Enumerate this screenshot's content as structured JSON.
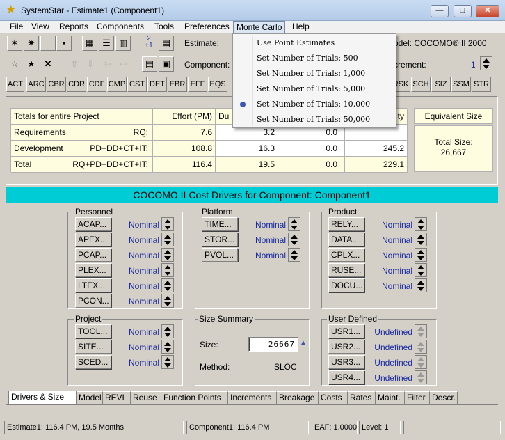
{
  "window": {
    "title": "SystemStar - Estimate1 (Component1)",
    "app_icon": "star-icon",
    "minimize": "—",
    "maximize": "□",
    "close": "✕"
  },
  "menubar": {
    "items": [
      "File",
      "View",
      "Reports",
      "Components",
      "Tools",
      "Preferences",
      "Monte Carlo",
      "Help"
    ]
  },
  "toolbar": {
    "estimate_label": "Estimate:",
    "component_label": "Component:",
    "model_label": "odel: COCOMO® II 2000",
    "increment_label": "crement:",
    "increment_value": "1",
    "fraction_top": "2",
    "fraction_bottom": "+1"
  },
  "cost_driver_buttons": [
    "ACT",
    "ARC",
    "CBR",
    "CDR",
    "CDF",
    "CMP",
    "CST",
    "DET",
    "EBR",
    "EFF",
    "EQS",
    "RSK",
    "SCH",
    "SIZ",
    "SSM",
    "STR"
  ],
  "totals": {
    "header": [
      "Totals for entire Project",
      "Effort (PM)",
      "Du",
      "",
      "ty"
    ],
    "rows": [
      {
        "name": "Requirements",
        "formula": "RQ:",
        "effort": "7.6",
        "duration": "3.2",
        "staff": "0.0",
        "productivity": ""
      },
      {
        "name": "Development",
        "formula": "PD+DD+CT+IT:",
        "effort": "108.8",
        "duration": "16.3",
        "staff": "0.0",
        "productivity": "245.2"
      },
      {
        "name": "Total",
        "formula": "RQ+PD+DD+CT+IT:",
        "effort": "116.4",
        "duration": "19.5",
        "staff": "0.0",
        "productivity": "229.1"
      }
    ],
    "equivalent_size": {
      "header": "Equivalent Size",
      "label": "Total Size:",
      "value": "26,667"
    }
  },
  "cost_drivers": {
    "title": "COCOMO II Cost Drivers for Component: Component1",
    "personnel": {
      "title": "Personnel",
      "items": [
        {
          "label": "ACAP...",
          "value": "Nominal"
        },
        {
          "label": "APEX...",
          "value": "Nominal"
        },
        {
          "label": "PCAP...",
          "value": "Nominal"
        },
        {
          "label": "PLEX...",
          "value": "Nominal"
        },
        {
          "label": "LTEX...",
          "value": "Nominal"
        },
        {
          "label": "PCON...",
          "value": "Nominal"
        }
      ]
    },
    "platform": {
      "title": "Platform",
      "items": [
        {
          "label": "TIME...",
          "value": "Nominal"
        },
        {
          "label": "STOR...",
          "value": "Nominal"
        },
        {
          "label": "PVOL...",
          "value": "Nominal"
        }
      ]
    },
    "product": {
      "title": "Product",
      "items": [
        {
          "label": "RELY...",
          "value": "Nominal"
        },
        {
          "label": "DATA...",
          "value": "Nominal"
        },
        {
          "label": "CPLX...",
          "value": "Nominal"
        },
        {
          "label": "RUSE...",
          "value": "Nominal"
        },
        {
          "label": "DOCU...",
          "value": "Nominal"
        }
      ]
    },
    "project": {
      "title": "Project",
      "items": [
        {
          "label": "TOOL...",
          "value": "Nominal"
        },
        {
          "label": "SITE...",
          "value": "Nominal"
        },
        {
          "label": "SCED...",
          "value": "Nominal"
        }
      ]
    },
    "size_summary": {
      "title": "Size Summary",
      "size_label": "Size:",
      "size_value": "26667",
      "method_label": "Method:",
      "method_value": "SLOC"
    },
    "user_defined": {
      "title": "User Defined",
      "items": [
        {
          "label": "USR1...",
          "value": "Undefined"
        },
        {
          "label": "USR2...",
          "value": "Undefined"
        },
        {
          "label": "USR3...",
          "value": "Undefined"
        },
        {
          "label": "USR4...",
          "value": "Undefined"
        }
      ]
    }
  },
  "tabs": [
    "Drivers & Size",
    "Model",
    "REVL",
    "Reuse",
    "Function Points",
    "Increments",
    "Breakage",
    "Costs",
    "Rates",
    "Maint.",
    "Filter",
    "Descr."
  ],
  "active_tab": "Drivers & Size",
  "statusbar": {
    "estimate": "Estimate1:  116.4 PM,  19.5 Months",
    "component": "Component1:  116.4 PM",
    "eaf": "EAF: 1.0000",
    "level": "Level:   1"
  },
  "monte_carlo_menu": {
    "items": [
      "Use Point Estimates",
      "Set Number of Trials: 500",
      "Set Number of Trials: 1,000",
      "Set Number of Trials: 5,000",
      "Set Number of Trials: 10,000",
      "Set Number of Trials: 50,000"
    ],
    "selected": "Set Number of Trials: 10,000"
  },
  "colors": {
    "accent_cyan": "#00ccd6",
    "value_blue": "#1a2aa0",
    "cream": "#fffde0"
  }
}
